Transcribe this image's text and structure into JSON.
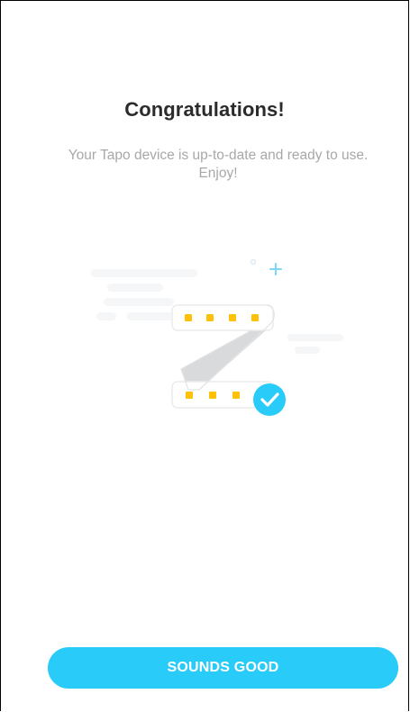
{
  "title": "Congratulations!",
  "message": "Your Tapo device is up-to-date and ready to use. Enjoy!",
  "illustration": {
    "icon": "light-strip-check-icon",
    "success_color": "#29ccf8",
    "led_color": "#ffc107"
  },
  "primary_button": {
    "label": "SOUNDS GOOD",
    "color": "#29ccf8"
  }
}
